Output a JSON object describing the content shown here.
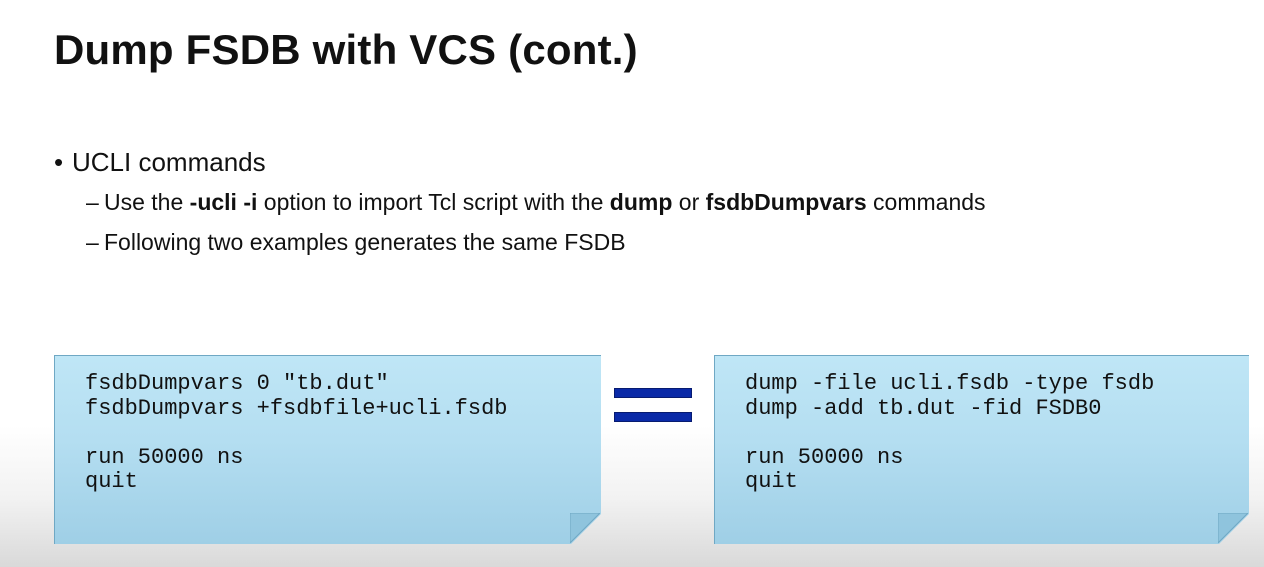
{
  "slide": {
    "title": "Dump FSDB with VCS (cont.)"
  },
  "bullets": {
    "main": {
      "marker": "•",
      "text": "UCLI commands"
    },
    "sub": [
      {
        "marker": "–",
        "parts": [
          "Use the ",
          "-ucli -i",
          " option to import Tcl script with the ",
          "dump",
          " or ",
          "fsdbDumpvars",
          " commands"
        ]
      },
      {
        "marker": "–",
        "text": "Following two examples generates the same FSDB"
      }
    ]
  },
  "code_left": {
    "lines": [
      "fsdbDumpvars 0 \"tb.dut\"",
      "fsdbDumpvars +fsdbfile+ucli.fsdb",
      "",
      "run 50000 ns",
      "quit"
    ]
  },
  "code_right": {
    "lines": [
      "dump -file ucli.fsdb -type fsdb",
      "dump -add tb.dut -fid FSDB0",
      "",
      "run 50000 ns",
      "quit"
    ]
  },
  "equals_sign": {
    "color": "#0a2aa8"
  },
  "colors": {
    "box_fill": "#b4def1",
    "box_border": "#6fa8c4"
  }
}
